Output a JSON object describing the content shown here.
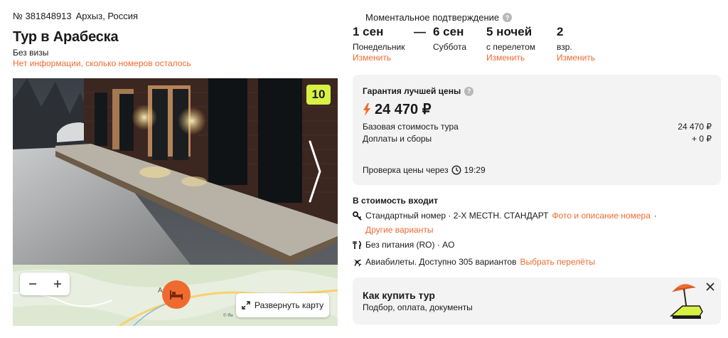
{
  "header": {
    "tour_number": "№ 381848913",
    "location": "Архыз, Россия",
    "title": "Тур в Арабеска",
    "visa": "Без визы",
    "rooms_info": "Нет информации, сколько номеров осталось"
  },
  "gallery": {
    "photo_count": "10",
    "next_icon": "chevron-right-icon"
  },
  "map": {
    "zoom_out": "−",
    "zoom_in": "+",
    "place_letter": "А",
    "expand_label": "Развернуть карту",
    "copyright": "© Ян"
  },
  "confirmation": {
    "label": "Моментальное подтверждение",
    "help_icon": "?"
  },
  "dates": {
    "start": {
      "big": "1 сен",
      "small": "Понедельник",
      "change": "Изменить"
    },
    "dash": "—",
    "end": {
      "big": "6 сен",
      "small": "Суббота"
    },
    "nights": {
      "big": "5 ночей",
      "small": "с перелетом",
      "change": "Изменить"
    },
    "guests": {
      "big": "2",
      "small": "взр.",
      "change": "Изменить"
    }
  },
  "price": {
    "guarantee_label": "Гарантия лучшей цены",
    "help_icon": "?",
    "total": "24 470 ₽",
    "base_label": "Базовая стоимость тура",
    "base_value": "24 470 ₽",
    "fees_label": "Доплаты и сборы",
    "fees_value": "+ 0 ₽",
    "check_label": "Проверка цены через",
    "check_time": "19:29"
  },
  "included": {
    "title": "В стоимость входит",
    "room_text": "Стандартный номер · 2-Х МЕСТН. СТАНДАРТ",
    "room_link": "Фото и описание номера",
    "room_sep": "·",
    "other_variants": "Другие варианты",
    "meals": "Без питания (RO) · AO",
    "flights_text": "Авиабилеты. Доступно 305 вариантов",
    "flights_link": "Выбрать перелёты"
  },
  "howto": {
    "title": "Как купить тур",
    "subtitle": "Подбор, оплата, документы"
  },
  "colors": {
    "accent": "#f06a30",
    "badge": "#d7f243",
    "card_bg": "#f3f3f3"
  }
}
